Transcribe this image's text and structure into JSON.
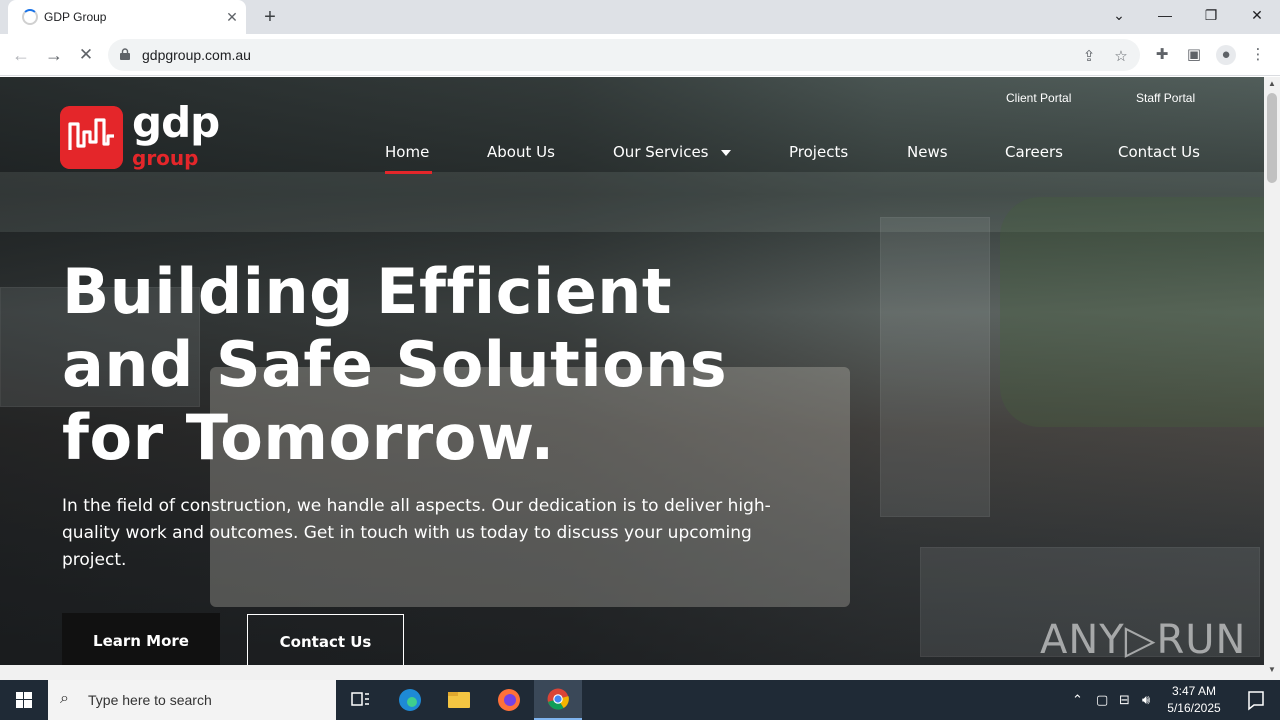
{
  "browser": {
    "tab_title": "GDP Group",
    "tab_close": "✕",
    "new_tab": "+",
    "url": "gdpgroup.com.au",
    "window_controls": {
      "dropdown": "⌄",
      "minimize": "—",
      "restore": "❐",
      "close": "✕"
    }
  },
  "site": {
    "logo": {
      "top": "gdp",
      "bottom": "group"
    },
    "portals": {
      "client": "Client Portal",
      "staff": "Staff Portal"
    },
    "nav": {
      "home": "Home",
      "about": "About Us",
      "services": "Our Services",
      "projects": "Projects",
      "news": "News",
      "careers": "Careers",
      "contact": "Contact Us"
    },
    "active_nav": "Home",
    "hero": {
      "title_line1": "Building Efficient",
      "title_line2": "and Safe Solutions",
      "title_line3": "for Tomorrow.",
      "body": "In the field of construction, we handle all aspects. Our dedication is to deliver high-quality work and outcomes. Get in touch with us today to discuss your upcoming project.",
      "learn_more": "Learn More",
      "contact_us": "Contact Us"
    },
    "accent_color": "#e4262a"
  },
  "watermark": "ANY▷RUN",
  "taskbar": {
    "search_placeholder": "Type here to search",
    "time": "3:47 AM",
    "date": "5/16/2025"
  }
}
